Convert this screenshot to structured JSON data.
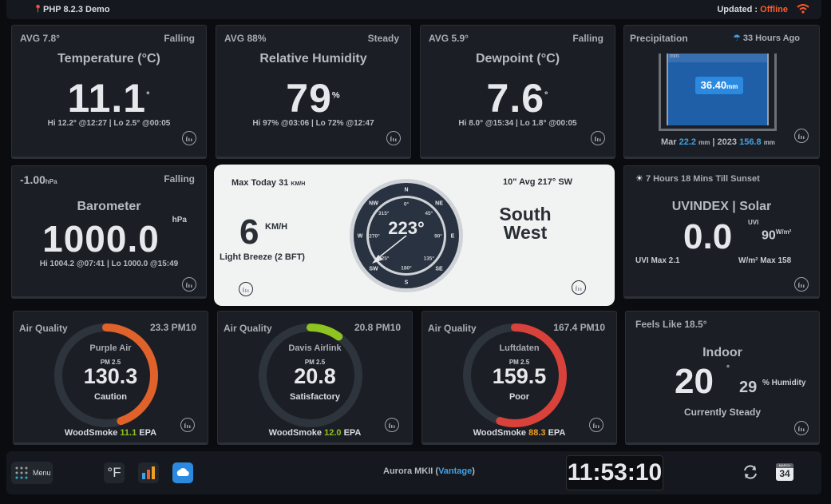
{
  "topbar": {
    "version": "PHP 8.2.3 Demo",
    "updated_label": "Updated :",
    "updated_value": "Offline",
    "pin_icon": "map-pin-icon",
    "wifi_icon": "wifi-icon"
  },
  "temperature": {
    "avg": "AVG 7.8°",
    "trend": "Falling",
    "title": "Temperature (°C)",
    "value": "11.1",
    "unit": "°",
    "stats": "Hi 12.2° @12:27 | Lo 2.5° @00:05"
  },
  "humidity": {
    "avg": "AVG 88%",
    "trend": "Steady",
    "title": "Relative Humidity",
    "value": "79",
    "unit": "%",
    "stats": "Hi 97% @03:06 | Lo 72% @12:47"
  },
  "dewpoint": {
    "avg": "AVG 5.9°",
    "trend": "Falling",
    "title": "Dewpoint (°C)",
    "value": "7.6",
    "unit": "°",
    "stats": "Hi 8.0° @15:34 | Lo 1.8° @00:05"
  },
  "precip": {
    "title": "Precipitation",
    "ago": "33 Hours Ago",
    "value": "36.40",
    "unit": "mm",
    "scale_unit": "mm",
    "month_label": "Mar",
    "month_value": "22.2",
    "month_unit": "mm",
    "year_label": "2023",
    "year_value": "156.8",
    "year_unit": "mm"
  },
  "barometer": {
    "change": "-1.00",
    "change_unit": "hPa",
    "trend": "Falling",
    "title": "Barometer",
    "value": "1000.0",
    "unit": "hPa",
    "stats": "Hi 1004.2 @07:41 | Lo 1000.0 @15:49"
  },
  "wind": {
    "max_today": "Max Today 31",
    "max_unit": "KM/H",
    "avg": "10\" Avg 217° SW",
    "speed": "6",
    "speed_unit": "KM/H",
    "desc": "Light Breeze (2 BFT)",
    "direction_deg": "223°",
    "direction_text_1": "South",
    "direction_text_2": "West",
    "compass": [
      "N",
      "NE",
      "E",
      "SE",
      "S",
      "SW",
      "W",
      "NW"
    ],
    "degrees": [
      "0°",
      "45°",
      "90°",
      "135°",
      "180°",
      "225°",
      "270°",
      "315°"
    ]
  },
  "uv": {
    "sunset": "7 Hours 18 Mins Till Sunset",
    "title": "UVINDEX | Solar",
    "value": "0.0",
    "uv_unit": "UVI",
    "solar": "90",
    "solar_unit": "W/m²",
    "uv_max": "UVI Max 2.1",
    "solar_max": "W/m² Max 158"
  },
  "aq": [
    {
      "label": "Air Quality",
      "pm10": "23.3 PM10",
      "source": "Purple Air",
      "pm": "PM 2.5",
      "value": "130.3",
      "status": "Caution",
      "ws_label": "WoodSmoke",
      "ws_value": "11.1",
      "ws_unit": "EPA",
      "level": 0.45,
      "color": "#e0622a"
    },
    {
      "label": "Air Quality",
      "pm10": "20.8 PM10",
      "source": "Davis Airlink",
      "pm": "PM 2.5",
      "value": "20.8",
      "status": "Satisfactory",
      "ws_label": "WoodSmoke",
      "ws_value": "12.0",
      "ws_unit": "EPA",
      "level": 0.1,
      "color": "#8fc31f"
    },
    {
      "label": "Air Quality",
      "pm10": "167.4 PM10",
      "source": "Luftdaten",
      "pm": "PM 2.5",
      "value": "159.5",
      "status": "Poor",
      "ws_label": "WoodSmoke",
      "ws_value": "88.3",
      "ws_unit": "EPA",
      "level": 0.55,
      "color": "#d9423a"
    }
  ],
  "indoor": {
    "feels": "Feels Like 18.5°",
    "title": "Indoor",
    "value": "20",
    "unit": "°",
    "humidity": "29",
    "humidity_label": "% Humidity",
    "status": "Currently Steady"
  },
  "bottom": {
    "menu": "Menu",
    "unit_btn": "°F",
    "station": "Aurora MKII (",
    "station_link": "Vantage",
    "station_end": ")",
    "time": "11:53:10",
    "cal_month": "MARCH",
    "cal_day": "34"
  }
}
